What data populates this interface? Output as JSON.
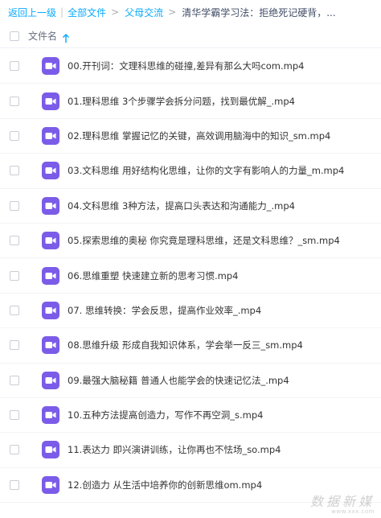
{
  "breadcrumb": {
    "back": "返回上一级",
    "all_files": "全部文件",
    "parent": "父母交流",
    "current": "清华学霸学习法：拒绝死记硬背，..."
  },
  "list_header": {
    "name_column": "文件名"
  },
  "files": [
    {
      "name": "00.开刊词：文理科思维的碰撞,差异有那么大吗com.mp4",
      "icon": "video-file-icon"
    },
    {
      "name": "01.理科思维 3个步骤学会拆分问题，找到最优解_.mp4",
      "icon": "video-file-icon"
    },
    {
      "name": "02.理科思维 掌握记忆的关键，高效调用脑海中的知识_sm.mp4",
      "icon": "video-file-icon"
    },
    {
      "name": "03.文科思维 用好结构化思维，让你的文字有影响人的力量_m.mp4",
      "icon": "video-file-icon"
    },
    {
      "name": "04.文科思维 3种方法，提高口头表达和沟通能力_.mp4",
      "icon": "video-file-icon"
    },
    {
      "name": "05.探索思维的奥秘 你究竟是理科思维，还是文科思维？_sm.mp4",
      "icon": "video-file-icon"
    },
    {
      "name": "06.思维重塑 快速建立新的思考习惯.mp4",
      "icon": "video-file-icon"
    },
    {
      "name": "07. 思维转换：学会反思，提高作业效率_.mp4",
      "icon": "video-file-icon"
    },
    {
      "name": "08.思维升级 形成自我知识体系，学会举一反三_sm.mp4",
      "icon": "video-file-icon"
    },
    {
      "name": "09.最强大脑秘籍 普通人也能学会的快速记忆法_.mp4",
      "icon": "video-file-icon"
    },
    {
      "name": "10.五种方法提高创造力，写作不再空洞_s.mp4",
      "icon": "video-file-icon"
    },
    {
      "name": "11.表达力 即兴演讲训练，让你再也不怯场_so.mp4",
      "icon": "video-file-icon"
    },
    {
      "name": "12.创造力 从生活中培养你的创新思维om.mp4",
      "icon": "video-file-icon"
    }
  ],
  "watermark": {
    "main": "数据新媒",
    "sub": "www.xxx.com"
  },
  "colors": {
    "link": "#09aaff",
    "video_icon": "#7b5ce8",
    "text": "#333333"
  }
}
